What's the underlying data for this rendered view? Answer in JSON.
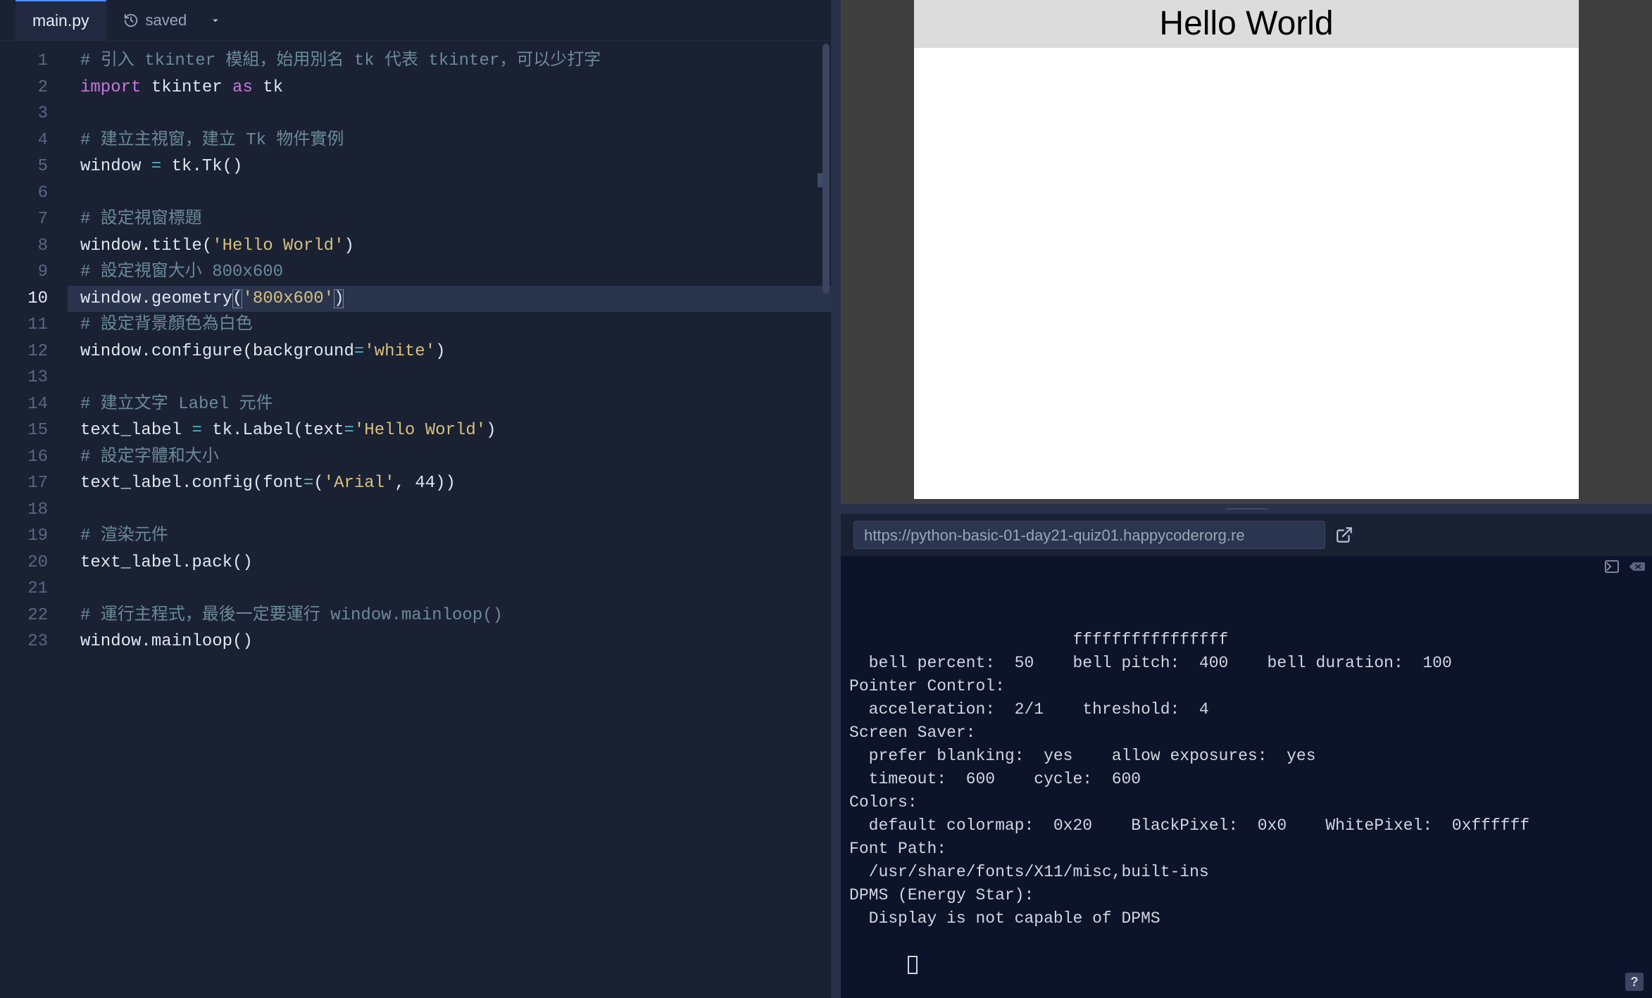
{
  "editor": {
    "tab_name": "main.py",
    "saved_label": "saved",
    "current_line_number": 10,
    "lines": [
      {
        "n": 1,
        "tokens": [
          [
            "comment",
            "# 引入 tkinter 模組，始用別名 tk 代表 tkinter，可以少打字"
          ]
        ]
      },
      {
        "n": 2,
        "tokens": [
          [
            "keyword",
            "import"
          ],
          [
            "default",
            " tkinter "
          ],
          [
            "keyword",
            "as"
          ],
          [
            "default",
            " tk"
          ]
        ]
      },
      {
        "n": 3,
        "tokens": []
      },
      {
        "n": 4,
        "tokens": [
          [
            "comment",
            "# 建立主視窗，建立 Tk 物件實例"
          ]
        ]
      },
      {
        "n": 5,
        "tokens": [
          [
            "default",
            "window "
          ],
          [
            "op",
            "="
          ],
          [
            "default",
            " tk.Tk()"
          ]
        ]
      },
      {
        "n": 6,
        "tokens": []
      },
      {
        "n": 7,
        "tokens": [
          [
            "comment",
            "# 設定視窗標題"
          ]
        ]
      },
      {
        "n": 8,
        "tokens": [
          [
            "default",
            "window.title("
          ],
          [
            "string",
            "'Hello World'"
          ],
          [
            "default",
            ")"
          ]
        ]
      },
      {
        "n": 9,
        "tokens": [
          [
            "comment",
            "# 設定視窗大小 800x600"
          ]
        ]
      },
      {
        "n": 10,
        "current": true,
        "tokens": [
          [
            "default",
            "window.geometry"
          ],
          [
            "brackethl",
            "("
          ],
          [
            "string",
            "'800x600'"
          ],
          [
            "brackethl",
            ")"
          ]
        ]
      },
      {
        "n": 11,
        "tokens": [
          [
            "comment",
            "# 設定背景顏色為白色"
          ]
        ]
      },
      {
        "n": 12,
        "tokens": [
          [
            "default",
            "window.configure(background"
          ],
          [
            "op",
            "="
          ],
          [
            "string",
            "'white'"
          ],
          [
            "default",
            ")"
          ]
        ]
      },
      {
        "n": 13,
        "tokens": []
      },
      {
        "n": 14,
        "tokens": [
          [
            "comment",
            "# 建立文字 Label 元件"
          ]
        ]
      },
      {
        "n": 15,
        "tokens": [
          [
            "default",
            "text_label "
          ],
          [
            "op",
            "="
          ],
          [
            "default",
            " tk.Label(text"
          ],
          [
            "op",
            "="
          ],
          [
            "string",
            "'Hello World'"
          ],
          [
            "default",
            ")"
          ]
        ]
      },
      {
        "n": 16,
        "tokens": [
          [
            "comment",
            "# 設定字體和大小"
          ]
        ]
      },
      {
        "n": 17,
        "tokens": [
          [
            "default",
            "text_label.config(font"
          ],
          [
            "op",
            "="
          ],
          [
            "default",
            "("
          ],
          [
            "string",
            "'Arial'"
          ],
          [
            "default",
            ", "
          ],
          [
            "default",
            "44))"
          ]
        ]
      },
      {
        "n": 18,
        "tokens": []
      },
      {
        "n": 19,
        "tokens": [
          [
            "comment",
            "# 渲染元件"
          ]
        ]
      },
      {
        "n": 20,
        "tokens": [
          [
            "default",
            "text_label.pack()"
          ]
        ]
      },
      {
        "n": 21,
        "tokens": []
      },
      {
        "n": 22,
        "tokens": [
          [
            "comment",
            "# 運行主程式，最後一定要運行 window.mainloop()"
          ]
        ]
      },
      {
        "n": 23,
        "tokens": [
          [
            "default",
            "window.mainloop()"
          ]
        ]
      }
    ]
  },
  "preview": {
    "window_title": "Hello World"
  },
  "url_bar": {
    "value": "https://python-basic-01-day21-quiz01.happycoderorg.re"
  },
  "terminal": {
    "lines": [
      "                       ffffffffffffffff",
      "  bell percent:  50    bell pitch:  400    bell duration:  100",
      "Pointer Control:",
      "  acceleration:  2/1    threshold:  4",
      "Screen Saver:",
      "  prefer blanking:  yes    allow exposures:  yes",
      "  timeout:  600    cycle:  600",
      "Colors:",
      "  default colormap:  0x20    BlackPixel:  0x0    WhitePixel:  0xffffff",
      "Font Path:",
      "  /usr/share/fonts/X11/misc,built-ins",
      "DPMS (Energy Star):",
      "  Display is not capable of DPMS"
    ]
  },
  "help_label": "?"
}
